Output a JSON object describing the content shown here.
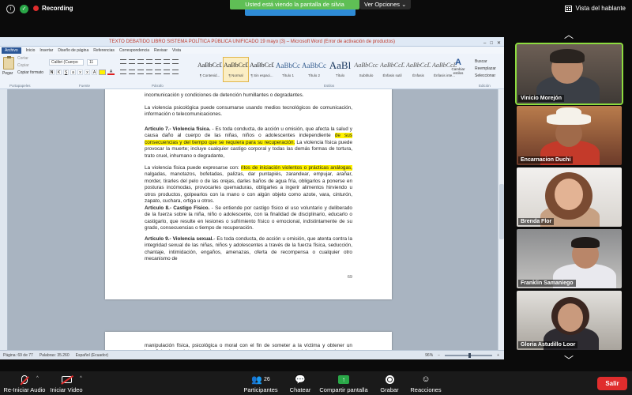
{
  "topbar": {
    "recording_label": "Recording",
    "share_banner": "Usted está viendo la pantalla de silvia",
    "view_options": "Ver Opciones",
    "speaker_view": "Vista del hablante"
  },
  "word": {
    "window_title": "TEXTO DEBATIDO LIBRO SISTEMA POLÍTICA PÚBLICA UNIFICADO 19 mayo (3) – Microsoft Word (Error de activación de productos)",
    "tabs": [
      "Archivo",
      "Inicio",
      "Insertar",
      "Diseño de página",
      "Referencias",
      "Correspondencia",
      "Revisar",
      "Vista"
    ],
    "clipboard": {
      "paste": "Pegar",
      "cut": "Cortar",
      "copy": "Copiar",
      "format_painter": "Copiar formato",
      "group": "Portapapeles"
    },
    "font": {
      "name": "Calibri (Cuerpo",
      "size": "11",
      "group": "Fuente"
    },
    "paragraph_group": "Párrafo",
    "styles_group": "Estilos",
    "styles": [
      {
        "preview": "AaBbCcDc",
        "name": "¶ Contenid..."
      },
      {
        "preview": "AaBbCcDd",
        "name": "¶ Normal"
      },
      {
        "preview": "AaBbCcDd",
        "name": "¶ Sin espaci..."
      },
      {
        "preview": "AaBbCc",
        "name": "Título 1"
      },
      {
        "preview": "AaBbCcI",
        "name": "Título 2"
      },
      {
        "preview": "AaBl",
        "name": "Título"
      },
      {
        "preview": "AaBbCcc",
        "name": "Subtítulo"
      },
      {
        "preview": "AaBbCcDd",
        "name": "Énfasis sutil"
      },
      {
        "preview": "AaBbCcDd",
        "name": "Énfasis"
      },
      {
        "preview": "AaBbCcDd",
        "name": "Énfasis inte..."
      }
    ],
    "change_styles": "Cambiar estilos",
    "editing": {
      "find": "Buscar",
      "replace": "Reemplazar",
      "select": "Seleccionar",
      "group": "Edición"
    },
    "page1": {
      "p0": "incomunicación y condiciones de detención humillantes o degradantes.",
      "p1": "La violencia psicológica puede consumarse usando medios tecnológicos de comunicación, información o telecomunicaciones.",
      "art7_title": "Artículo 7.- Violencia física.",
      "art7_a": " - Es toda conducta, de acción u omisión, que afecta la salud y causa daño al cuerpo de las niñas, niños o adolescentes independiente ",
      "art7_hl": "de sus consecuencias y del tiempo que se requiera para su recuperación.",
      "art7_b": " La violencia física puede provocar la muerte; incluye cualquier castigo corporal y todas las demás formas de tortura, trato cruel, inhumano o degradante,",
      "p3_a": "La violencia física puede expresarse con: ",
      "p3_hl": "ritos de iniciación violentos o prácticas análogas,",
      "p3_b": " nalgadas, manotazos, bofetadas, palizas, dar puntapiés, zarandear, empujar, arañar, morder, tirarles del pelo o de las orejas, darles baños de agua fría, obligarlos a ponerse en posturas incómodas, provocarles quemaduras, obligarles a ingerir alimentos hirviendo u otros productos, golpearlos con la mano o con algún objeto como azote, vara, cinturón, zapato, cuchara, ortiga u otros.",
      "art8_title": "Artículo 8.- Castigo Físico.",
      "art8_text": "- Se entiende por castigo físico el uso voluntario y deliberado de la fuerza sobre la niña, niño o adolescente, con la finalidad de disciplinario, educarlo o castigarlo, que resulte en lesiones o sufrimiento físico o emocional, indistintamente de su grado, consecuencias o tiempo de recuperación.",
      "art9_title": "Artículo 9.- Violencia sexual.",
      "art9_text": "- Es toda conducta, de acción u omisión, que atenta contra la integridad sexual de las niñas, niños y adolescentes a través de la fuerza física, seducción, chantaje, intimidación, engaños, amenazas, oferta de recompensa o cualquier otro mecanismo de",
      "page_number": "69"
    },
    "page2": {
      "p0": "manipulación física, psicológica o moral con el fin de someter a la víctima y obtener un beneficio de carácter sexual para sí mismo o para terceros.   La violencia sexual puede llevarse a cabo utilizando medios o tecnologías de la información y comunicación."
    },
    "status": {
      "page": "Página: 69 de 77",
      "words": "Palabras: 35.260",
      "language": "Español (Ecuador)",
      "zoom": "96%"
    }
  },
  "participants": [
    {
      "name": "Vinicio Morejón"
    },
    {
      "name": "Encarnacion Duchi"
    },
    {
      "name": "Brenda Flor"
    },
    {
      "name": "Franklin Samaniego"
    },
    {
      "name": "Gloria Astudillo Loor"
    }
  ],
  "controls": {
    "audio": "Re-Iniciar Audio",
    "video": "Iniciar Video",
    "participants": "Participantes",
    "participants_count": "26",
    "chat": "Chatear",
    "share": "Compartir pantalla",
    "record": "Grabar",
    "reactions": "Reacciones",
    "leave": "Salir"
  }
}
